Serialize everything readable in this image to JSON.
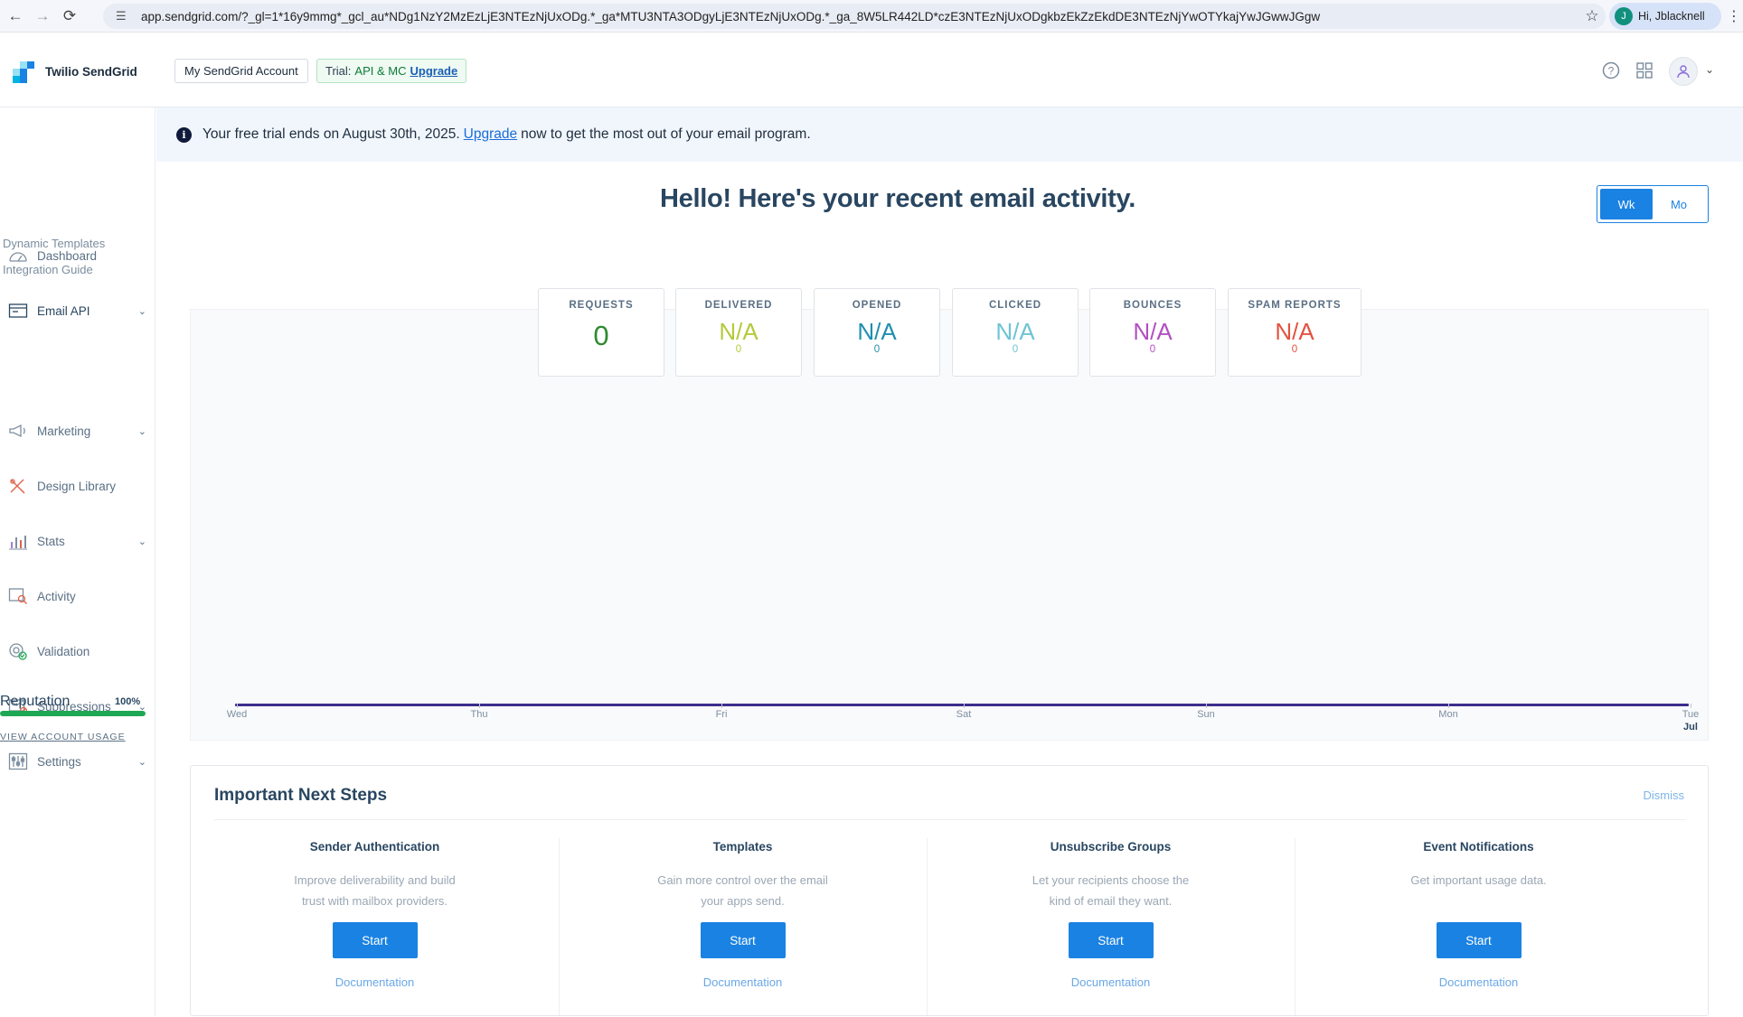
{
  "browser": {
    "url": "app.sendgrid.com/?_gl=1*16y9mmg*_gcl_au*NDg1NzY2MzEzLjE3NTEzNjUxODg.*_ga*MTU3NTA3ODgyLjE3NTEzNjUxODg.*_ga_8W5LR442LD*czE3NTEzNjUxODgkbzEkZzEkdDE3NTEzNjYwOTYkajYwJGwwJGgw",
    "profile_initial": "J",
    "profile_label": "Hi, Jblacknell"
  },
  "header": {
    "brand": "Twilio SendGrid",
    "account_button": "My SendGrid Account",
    "trial_prefix": "Trial:",
    "trial_plan": "API & MC",
    "trial_upgrade": "Upgrade"
  },
  "sidebar": {
    "items": [
      {
        "label": "Dashboard",
        "icon": "dashboard-gauge-icon",
        "chevron": false
      },
      {
        "label": "Email API",
        "icon": "email-api-icon",
        "chevron": true
      },
      {
        "label": "Marketing",
        "icon": "megaphone-icon",
        "chevron": true
      },
      {
        "label": "Design Library",
        "icon": "design-tools-icon",
        "chevron": false
      },
      {
        "label": "Stats",
        "icon": "stats-chart-icon",
        "chevron": true
      },
      {
        "label": "Activity",
        "icon": "activity-search-icon",
        "chevron": false
      },
      {
        "label": "Validation",
        "icon": "validation-at-icon",
        "chevron": false
      },
      {
        "label": "Suppressions",
        "icon": "suppressions-mail-icon",
        "chevron": true
      },
      {
        "label": "Settings",
        "icon": "settings-sliders-icon",
        "chevron": true
      }
    ],
    "sub_items": [
      "Dynamic Templates",
      "Integration Guide"
    ],
    "reputation_label": "Reputation",
    "reputation_value": "100%",
    "reputation_fraction": 1.0,
    "usage_link": "VIEW ACCOUNT USAGE"
  },
  "banner": {
    "text_before": "Your free trial ends on August 30th, 2025.",
    "link": "Upgrade",
    "text_after": "now to get the most out of your email program."
  },
  "main": {
    "heading": "Hello! Here's your recent email activity.",
    "toggle": [
      "Wk",
      "Mo"
    ],
    "toggle_selected": "Wk"
  },
  "metrics": [
    {
      "label": "REQUESTS",
      "value": "0",
      "sub": "",
      "color": "#2e8b2e"
    },
    {
      "label": "DELIVERED",
      "value": "N/A",
      "sub": "0",
      "color": "#b5c93a"
    },
    {
      "label": "OPENED",
      "value": "N/A",
      "sub": "0",
      "color": "#1f8fb0"
    },
    {
      "label": "CLICKED",
      "value": "N/A",
      "sub": "0",
      "color": "#6ec4d4"
    },
    {
      "label": "BOUNCES",
      "value": "N/A",
      "sub": "0",
      "color": "#b24fc2"
    },
    {
      "label": "SPAM REPORTS",
      "value": "N/A",
      "sub": "0",
      "color": "#e2523f"
    }
  ],
  "chart_data": {
    "type": "line",
    "categories": [
      "Wed",
      "Thu",
      "Fri",
      "Sat",
      "Sun",
      "Mon",
      "Tue"
    ],
    "x_sublabel": "Jul",
    "series": [],
    "values": [
      0,
      0,
      0,
      0,
      0,
      0,
      0
    ],
    "line_color": "#3b2e8c"
  },
  "next_steps": {
    "title": "Important Next Steps",
    "dismiss": "Dismiss",
    "items": [
      {
        "title": "Sender Authentication",
        "desc": "Improve deliverability and build trust with mailbox providers.",
        "button": "Start",
        "doc": "Documentation"
      },
      {
        "title": "Templates",
        "desc": "Gain more control over the email your apps send.",
        "button": "Start",
        "doc": "Documentation"
      },
      {
        "title": "Unsubscribe Groups",
        "desc": "Let your recipients choose the kind of email they want.",
        "button": "Start",
        "doc": "Documentation"
      },
      {
        "title": "Event Notifications",
        "desc": "Get important usage data.",
        "button": "Start",
        "doc": "Documentation"
      }
    ]
  }
}
